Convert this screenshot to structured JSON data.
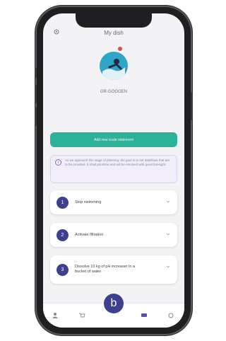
{
  "header": {
    "title": "My dish"
  },
  "profile": {
    "name": "GR-GOGGEN"
  },
  "actions": {
    "primary_button": "Add new scale statement"
  },
  "info": {
    "text": "As we approach this stage of planning, the goal is to set dataflows that are to be provided. It shall prioritise and will be resolved with good foresight."
  },
  "steps": [
    {
      "number": "1",
      "label": "Stop swimming"
    },
    {
      "number": "2",
      "label": "Activate filtration"
    },
    {
      "number": "3",
      "label": "Dissolve 10 kg of pH increaser in a bucket of water"
    }
  ],
  "bottom_nav": {
    "center_label": "b"
  },
  "colors": {
    "accent": "#3d3f8f",
    "primary_green": "#2bb39a",
    "avatar_blue": "#2fa6c8"
  }
}
